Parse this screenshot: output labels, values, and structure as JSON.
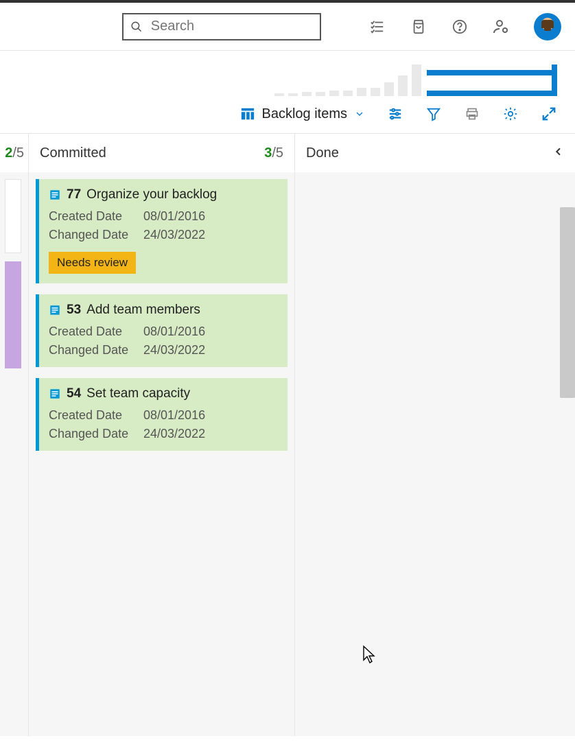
{
  "search": {
    "placeholder": "Search"
  },
  "toolbar": {
    "view_label": "Backlog items"
  },
  "columns": {
    "prev": {
      "count_shown": "2",
      "count_total": "/5"
    },
    "committed": {
      "title": "Committed",
      "count_shown": "3",
      "count_total": "/5"
    },
    "done": {
      "title": "Done"
    }
  },
  "cards": [
    {
      "id": "77",
      "title": "Organize your backlog",
      "created_label": "Created Date",
      "created": "08/01/2016",
      "changed_label": "Changed Date",
      "changed": "24/03/2022",
      "tag": "Needs review"
    },
    {
      "id": "53",
      "title": "Add team members",
      "created_label": "Created Date",
      "created": "08/01/2016",
      "changed_label": "Changed Date",
      "changed": "24/03/2022"
    },
    {
      "id": "54",
      "title": "Set team capacity",
      "created_label": "Created Date",
      "created": "08/01/2016",
      "changed_label": "Changed Date",
      "changed": "24/03/2022"
    }
  ],
  "chart_data": {
    "type": "bar",
    "categories": [
      "1",
      "2",
      "3",
      "4",
      "5",
      "6",
      "7",
      "8",
      "9",
      "10",
      "11"
    ],
    "values": [
      4,
      4,
      6,
      6,
      8,
      8,
      12,
      12,
      20,
      30,
      46
    ],
    "title": "",
    "xlabel": "",
    "ylabel": "",
    "ylim": [
      0,
      46
    ]
  }
}
